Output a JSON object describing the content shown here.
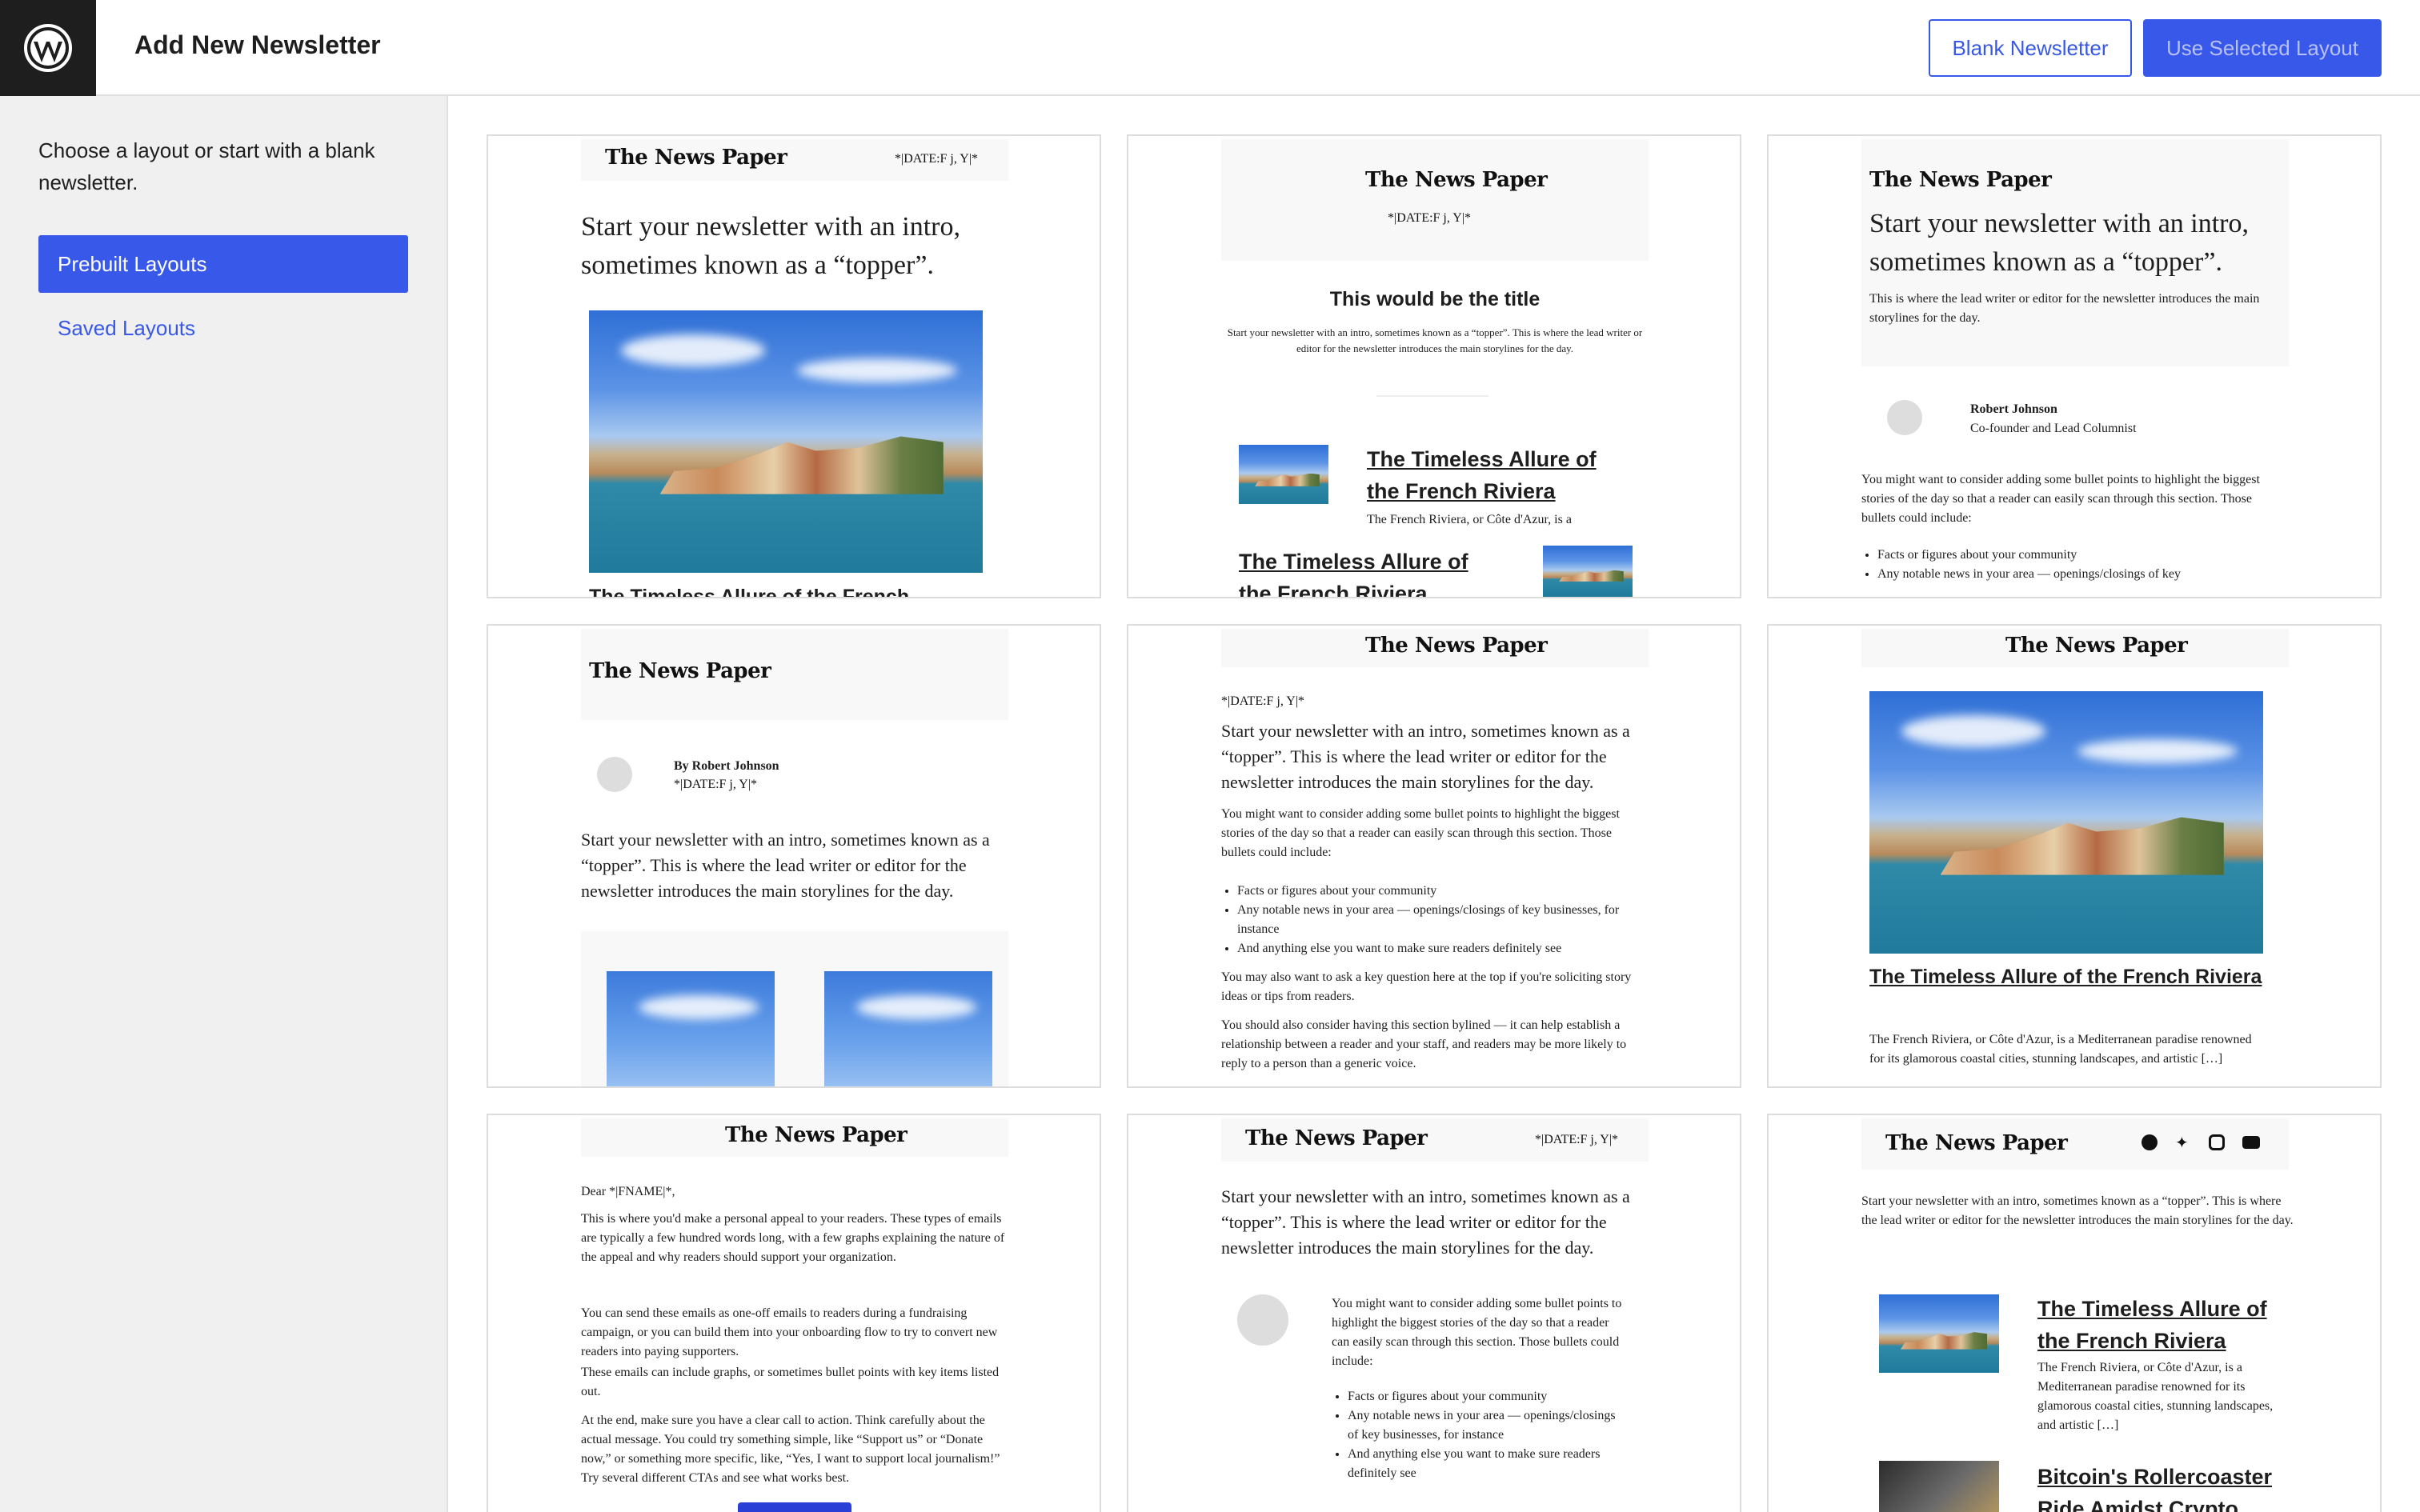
{
  "header": {
    "title": "Add New Newsletter",
    "blank_button": "Blank Newsletter",
    "use_button": "Use Selected Layout"
  },
  "sidebar": {
    "description": "Choose a layout or start with a blank newsletter.",
    "items": [
      {
        "label": "Prebuilt Layouts",
        "active": true
      },
      {
        "label": "Saved Layouts",
        "active": false
      }
    ]
  },
  "common": {
    "logo": "The News Paper",
    "date_tag": "*|DATE:F j, Y|*",
    "riviera_title": "The Timeless Allure of the French Riviera",
    "riviera_title_cut": "The Timeless Allure of the French",
    "intro_short": "Start your newsletter with an intro, sometimes known as a “topper”.",
    "intro_long": "Start your newsletter with an intro, sometimes known as a “topper”. This is where the lead writer or editor for the newsletter introduces the main storylines for the day.",
    "bullets_intro": "You might want to consider adding some bullet points to highlight the biggest stories of the day so that a reader can easily scan through this section. Those bullets could include:",
    "bullet_1": "Facts or figures about your community",
    "bullet_2": "Any notable news in your area — openings/closings of key businesses, for instance",
    "bullet_3": "And anything else you want to make sure readers definitely see"
  },
  "card2": {
    "title": "This would be the title",
    "excerpt": "The French Riviera, or Côte d'Azur, is a"
  },
  "card3": {
    "intro_sub": "This is where the lead writer or editor for the newsletter introduces the main storylines for the day.",
    "author": "Robert Johnson",
    "role": "Co-founder and Lead Columnist",
    "bullet_2_cut": "Any notable news in your area — openings/closings of key"
  },
  "card4": {
    "byline": "By Robert Johnson"
  },
  "card5": {
    "ask": "You may also want to ask a key question here at the top if you're soliciting story ideas or tips from readers.",
    "byline_note": "You should also consider having this section bylined — it can help establish a relationship between a reader and your staff, and readers may be more likely to reply to a person than a generic voice."
  },
  "card6": {
    "excerpt": "The French Riviera, or Côte d'Azur, is a Mediterranean paradise renowned for its glamorous coastal cities, stunning landscapes, and artistic […]"
  },
  "card7": {
    "greeting": "Dear *|FNAME|*,",
    "p1": "This is where you'd make a personal appeal to your readers. These types of emails are typically a few hundred words long, with a few graphs explaining the nature of the appeal and why readers should support your organization.",
    "p2": "You can send these emails as one-off emails to readers during a fundraising campaign, or you can build them into your onboarding flow to try to convert new readers into paying supporters.",
    "p3": "These emails can include graphs, or sometimes bullet points with key items listed out.",
    "p4": "At the end, make sure you have a clear call to action. Think carefully about the actual message. You could try something simple, like “Support us” or “Donate now,” or something more specific, like, “Yes, I want to support local journalism!” Try several different CTAs and see what works best."
  },
  "card8": {
    "bullets_intro": "You might want to consider adding some bullet points to highlight the biggest stories of the day so that a reader can easily scan through this section. Those bullets could include:",
    "bullet_2": "Any notable news in your area — openings/closings of key businesses, for instance"
  },
  "card9": {
    "excerpt": "The French Riviera, or Côte d'Azur, is a Mediterranean paradise renowned for its glamorous coastal cities, stunning landscapes, and artistic […]",
    "title2": "Bitcoin's Rollercoaster Ride Amidst Crypto"
  }
}
